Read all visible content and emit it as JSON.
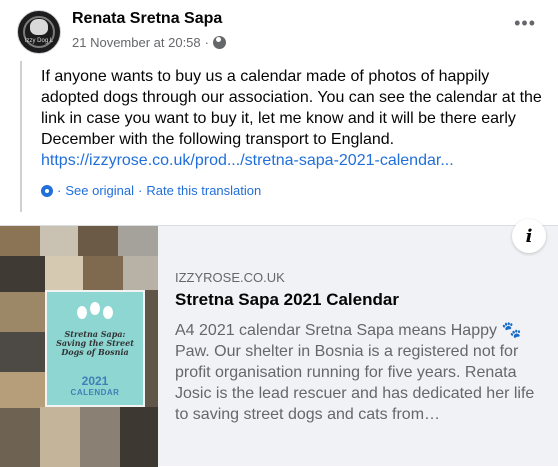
{
  "post": {
    "author": "Renata Sretna Sapa",
    "timestamp": "21 November at 20:58",
    "separator": "·",
    "avatar_text": "Izzy Dog L",
    "more_icon": "more-options-icon",
    "text": "If anyone wants to buy us a calendar made of photos of happily adopted dogs through our association. You can see the calendar at the link in case you want to buy it, let me know and it will be there early December with the following transport to England.",
    "link": "https://izzyrose.co.uk/prod.../stretna-sapa-2021-calendar...",
    "translation": {
      "see_original": "See original",
      "rate": "Rate this translation",
      "sep1": "·",
      "sep2": "·"
    }
  },
  "link_preview": {
    "domain": "IZZYROSE.CO.UK",
    "title": "Stretna Sapa 2021 Calendar",
    "description": "A4 2021 calendar Sretna Sapa means Happy 🐾 Paw. Our shelter in Bosnia is a registered not for profit organisation running for five years. Renata Josic is the lead rescuer and has dedicated her life to saving street dogs and cats from…",
    "info_icon": "i",
    "calendar_cover": {
      "title": "Stretna Sapa: Saving the Street Dogs of Bosnia",
      "year": "2021",
      "word": "CALENDAR"
    }
  },
  "colors": {
    "link": "#216fdb",
    "secondary_text": "#65676b",
    "card_bg": "#f0f2f5",
    "calendar_teal": "#8ed6d2"
  }
}
